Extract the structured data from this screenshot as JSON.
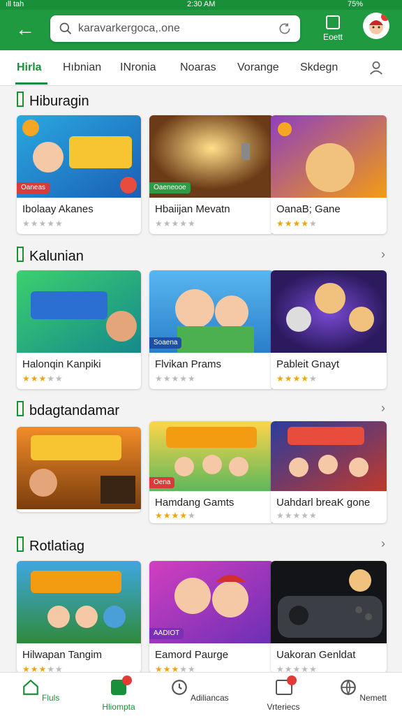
{
  "status_bar": {
    "carrier": "ıll tah",
    "time": "2:30 AM",
    "battery": "75%"
  },
  "header": {
    "search_text": "karavarkergoca,.one",
    "store_label": "Eoett"
  },
  "tabs": [
    "Hirla",
    "Hıbnian",
    "INronia",
    "Noaras",
    "Vorange",
    "Skdegn"
  ],
  "sections": [
    {
      "title": "Hiburagin",
      "cards": [
        {
          "name": "Ibolaay Akanes",
          "badge": "Oaneas",
          "rating": 0,
          "badge_color": "#d93b3b"
        },
        {
          "name": "Hbaiijan Mevatn",
          "badge": "Oaeneooe",
          "rating": 0,
          "badge_color": "#2e9b45"
        },
        {
          "name": "OanaB; Gane",
          "badge": "",
          "rating": 4.5,
          "badge_color": "#d93b3b"
        }
      ]
    },
    {
      "title": "Kalunian",
      "cards": [
        {
          "name": "Halonqin Kanpiki",
          "badge": "",
          "rating": 3,
          "badge_color": "#d93b3b"
        },
        {
          "name": "Flvikan Prams",
          "badge": "Soaena",
          "rating": 0,
          "badge_color": "#1c4fa5"
        },
        {
          "name": "Pableit Gnayt",
          "badge": "",
          "rating": 4,
          "badge_color": "#d93b3b"
        }
      ]
    },
    {
      "title": "bdagtandamar",
      "cards": [
        {
          "name": "",
          "badge": "",
          "rating": 0,
          "badge_color": "#d93b3b"
        },
        {
          "name": "Hamdang Gamts",
          "badge": "Oena",
          "rating": 4,
          "badge_color": "#d93b3b"
        },
        {
          "name": "Uahdarl breaK gone",
          "badge": "",
          "rating": 0,
          "badge_color": "#d93b3b"
        }
      ]
    },
    {
      "title": "Rotlatiag",
      "cards": [
        {
          "name": "Hilwapan Tangim",
          "badge": "",
          "rating": 3,
          "badge_color": "#d93b3b"
        },
        {
          "name": "Eamord Paurge",
          "badge": "AADIOT",
          "rating": 3,
          "badge_color": "#7c2fb6"
        },
        {
          "name": "Uakoran Genldat",
          "badge": "",
          "rating": 0,
          "badge_color": "#d93b3b"
        }
      ]
    }
  ],
  "bottom_nav": [
    {
      "label": "Fluls",
      "icon": "home-icon"
    },
    {
      "label": "Hliompta",
      "icon": "apps-icon"
    },
    {
      "label": "Adiliancas",
      "icon": "search-history-icon"
    },
    {
      "label": "Vrteriecs",
      "icon": "library-icon"
    },
    {
      "label": "Nemett",
      "icon": "globe-icon"
    }
  ]
}
